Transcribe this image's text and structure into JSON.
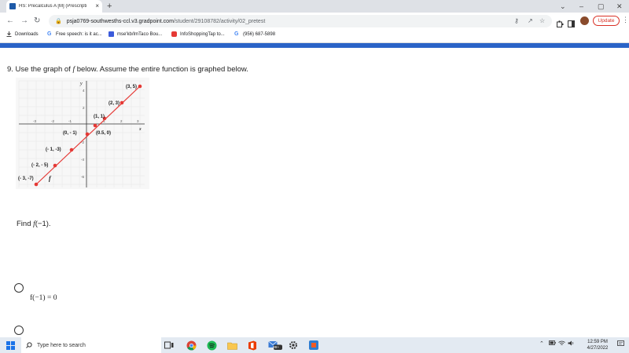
{
  "browser": {
    "tab_title": "HS: Precalculus A [M] (Prescripti",
    "tab_close": "×",
    "new_tab": "+",
    "window_controls": [
      "⌄",
      "–",
      "▢",
      "✕"
    ],
    "url_host": "psja0769-southwesths-ccl.v3.gradpoint.com",
    "url_path": "/student/29108782/activity/02_pretest",
    "update_label": "Update"
  },
  "bookmarks": [
    {
      "label": "Downloads",
      "icon": "download-icon"
    },
    {
      "label": "Free speech: is it ac...",
      "icon": "google-icon"
    },
    {
      "label": "mse'kb/ImTaco Bou...",
      "icon": "page-icon"
    },
    {
      "label": "InfoShoppingTap to...",
      "icon": "youtube-icon"
    },
    {
      "label": "(956) 687-5898",
      "icon": "google-icon"
    }
  ],
  "question": {
    "prefix": "9. Use the graph of ",
    "function": "f",
    "suffix": " below. Assume the entire function is graphed below."
  },
  "graph": {
    "axis_y": "y",
    "axis_x": "x",
    "curve_label": "f",
    "x_ticks": [
      "-3",
      "-2",
      "-1",
      "1",
      "2",
      "3"
    ],
    "y_ticks": [
      "4",
      "2",
      "-2",
      "-4",
      "-6"
    ],
    "point_labels": [
      "(3, 5)",
      "(2, 3)",
      "(1, 1)",
      "(0, - 1)",
      "(0.5, 0)",
      "(- 1, -3)",
      "(- 2, - 5)",
      "(- 3, -7)"
    ],
    "line_color": "#e53935",
    "point_color": "#e53935"
  },
  "find": {
    "prefix": "Find ",
    "function": "f",
    "suffix": "(−1)."
  },
  "answer_options": [
    "f(−1) = 0"
  ],
  "taskbar": {
    "search_placeholder": "Type here to search",
    "notification_badge": "99+",
    "time": "12:59 PM",
    "date": "4/27/2022"
  }
}
